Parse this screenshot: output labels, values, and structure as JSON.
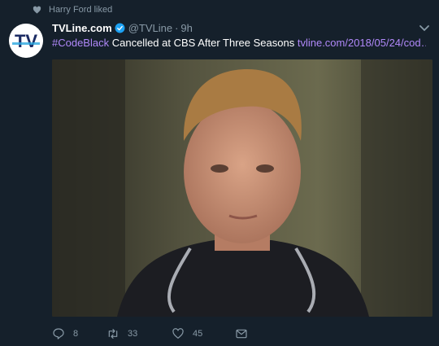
{
  "social_context": {
    "text": "Harry Ford liked"
  },
  "author": {
    "name": "TVLine.com",
    "handle": "@TVLine",
    "separator": "·",
    "time": "9h",
    "avatar_text": "TV"
  },
  "tweet": {
    "hashtag": "#CodeBlack",
    "text": " Cancelled at CBS After Three Seasons ",
    "link": "tvline.com/2018/05/24/cod…"
  },
  "actions": {
    "replies": "8",
    "retweets": "33",
    "likes": "45"
  },
  "colors": {
    "background": "#15202b",
    "accent": "#b088f9",
    "muted": "#8899a6",
    "verified": "#1da1f2"
  }
}
